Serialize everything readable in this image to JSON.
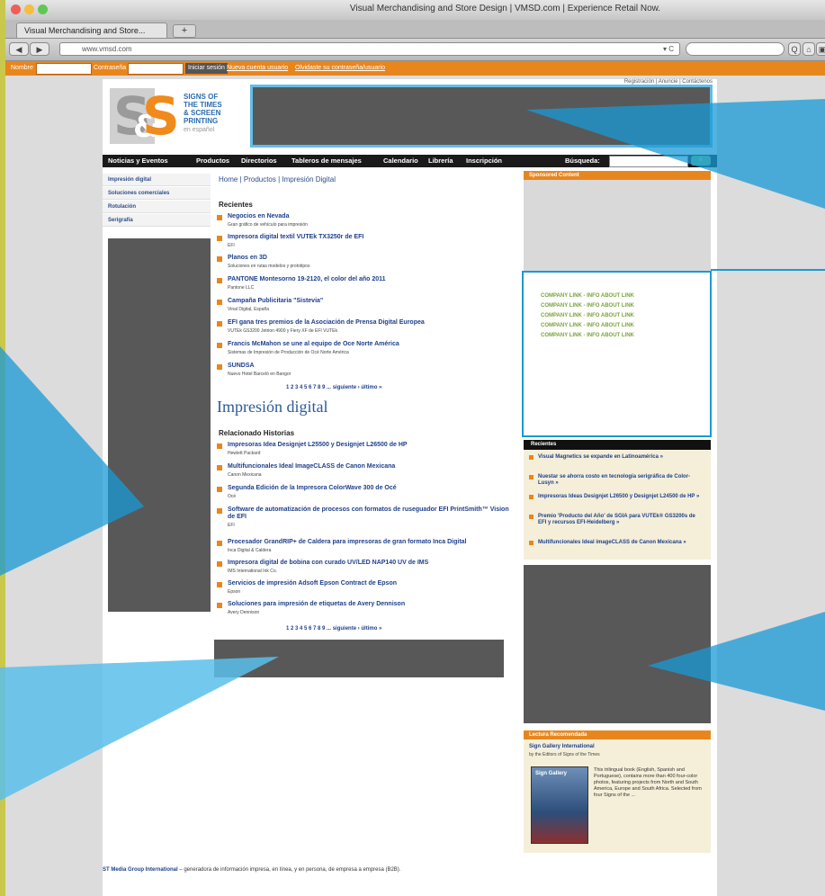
{
  "window": {
    "title": "Visual Merchandising and Store Design | VMSD.com | Experience Retail Now."
  },
  "tab": {
    "label": "Visual Merchandising and Store...",
    "new_tab": "+"
  },
  "navbar": {
    "back": "◀",
    "forward": "▶",
    "url": "www.vmsd.com",
    "url_controls": "▾ C",
    "reload": "",
    "search_placeholder": "",
    "btn_search": "Q",
    "btn_home": "⌂",
    "btn_page": "▣"
  },
  "bookmarks": {
    "label1": "Nombre",
    "label2": "Contraseña",
    "login": "Iniciar sesión",
    "link1": "Nueva cuenta usuario",
    "link2": "Olvidaste su contraseña/usuario"
  },
  "site": {
    "logo_letters": [
      "S",
      "&",
      "S"
    ],
    "logo_lines": [
      "SIGNS OF",
      "THE TIMES",
      "& SCREEN",
      "PRINTING"
    ],
    "logo_sub": "en español",
    "top_links": "Registración  |  Anuncie  |  Contáctenos"
  },
  "main_nav": [
    "Noticias y Eventos",
    "Productos",
    "Directorios",
    "Tableros de mensajes",
    "Calendario",
    "Librería",
    "Inscripción"
  ],
  "nav_search": {
    "label": "Búsqueda:",
    "button": "Ir"
  },
  "left_nav": [
    "Impresión digital",
    "Soluciones comerciales",
    "Rotulación",
    "Serigrafía"
  ],
  "breadcrumb": "Home  |  Productos  |  Impresión Digital",
  "recientes": {
    "heading": "Recientes",
    "items": [
      {
        "title": "Negocios en Nevada",
        "sub": "Gran gráfico de vehículo para impresión"
      },
      {
        "title": "Impresora digital textil VUTEk TX3250r de EFI",
        "sub": "EFI"
      },
      {
        "title": "Planos en 3D",
        "sub": "Soluciones en rutas modelos y prototipos"
      },
      {
        "title": "PANTONE Montesorno 19-2120, el color del año 2011",
        "sub": "Pantone LLC"
      },
      {
        "title": "Campaña Publicitaria \"Sistevia\"",
        "sub": "Vinal Digital, España"
      },
      {
        "title": "EFI gana tres premios de la Asociación de Prensa Digital Europea",
        "sub": "VUTEk GS3200 Jetrion 4900 y Fiery XF de EFI VUTEk"
      },
      {
        "title": "Francis McMahon se une al equipo de Oce Norte América",
        "sub": "Sistemas de Impresión de Producción de Océ Norte América"
      },
      {
        "title": "SUNDSA",
        "sub": "Nuevo Hotel Barceló en Bangor"
      }
    ],
    "pager": "1  2  3  4  5  6  7  8  9 ...  siguiente ›  último »"
  },
  "section_title": "Impresión digital",
  "relacionado": {
    "heading": "Relacionado Historias",
    "items": [
      {
        "title": "Impresoras Idea Designjet L25500 y Designjet L26500 de HP",
        "sub": "Hewlett Packard"
      },
      {
        "title": "Multifuncionales Ideal ImageCLASS de Canon Mexicana",
        "sub": "Canon Mexicana"
      },
      {
        "title": "Segunda Edición de la Impresora ColorWave 300 de Océ",
        "sub": "Océ"
      },
      {
        "title": "Software de automatización de procesos con formatos de ruseguador EFI PrintSmith™ Vision de EFI",
        "sub": "EFI"
      },
      {
        "title": "Procesador GrandRIP+ de Caldera para impresoras de gran formato Inca Digital",
        "sub": "Inca Digital & Caldera"
      },
      {
        "title": "Impresora digital de bobina con curado UV/LED NAP140 UV de IMS",
        "sub": "IMS International Ink Co."
      },
      {
        "title": "Servicios de impresión Adsoft Epson Contract de Epson",
        "sub": "Epson"
      },
      {
        "title": "Soluciones para impresión de etiquetas de Avery Dennison",
        "sub": "Avery Dennison"
      }
    ],
    "pager": "1  2  3  4  5  6  7  8  9 ...  siguiente ›  último »"
  },
  "sponsored": {
    "heading": "Sponsored Content",
    "links": [
      "COMPANY LINK - INFO ABOUT LINK",
      "COMPANY LINK - INFO ABOUT LINK",
      "COMPANY LINK - INFO ABOUT LINK",
      "COMPANY LINK - INFO ABOUT LINK",
      "COMPANY LINK - INFO ABOUT LINK"
    ]
  },
  "right_recent": {
    "heading": "Recientes",
    "items": [
      "Visual Magnetics se expande en Latinoamérica »",
      "Nuestar se ahorra costo en tecnología serigráfica de Color-Lusyn »",
      "Impresoras Ideas Designjet L26500 y Designjet L24500 de HP »",
      "Premio 'Producto del Año' de SGIA para VUTEk® GS3200s de EFI y recursos EFI-Heidelberg »",
      "Multifuncionales Ideal imageCLASS de Canon Mexicana »"
    ]
  },
  "book": {
    "heading": "Lectura Recomendada",
    "title": "Sign Gallery International",
    "author": "by the Editors of Signs of the Times",
    "description": "This trilingual book (English, Spanish and Portuguese), contains more than 400 four-color photos, featuring projects from North and South America, Europe and South Africa. Selected from four Signs of the ...",
    "cover_text": "Sign Gallery"
  },
  "footer": {
    "link": "ST Media Group International",
    "text": " – generadora de información impresa, en línea, y en persona, de empresa a empresa (B2B)."
  },
  "colors": {
    "accent_orange": "#e8861e",
    "nav_black": "#1a1a1a",
    "link_blue": "#1d3f8c",
    "overlay_blue": "#1a9ad6",
    "page_bg": "#c9c84a",
    "company_link_green": "#79a33a"
  }
}
